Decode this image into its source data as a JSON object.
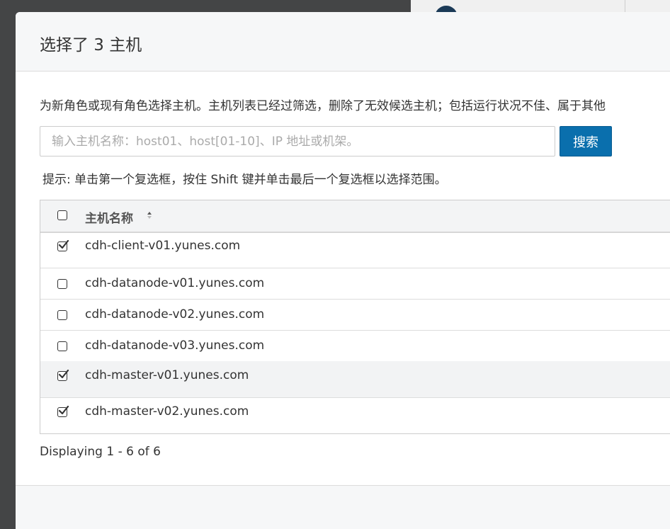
{
  "dialog": {
    "title": "选择了 3 主机",
    "description": "为新角色或现有角色选择主机。主机列表已经过筛选，删除了无效候选主机；包括运行状况不佳、属于其他",
    "search_placeholder": "输入主机名称：host01、host[01-10]、IP 地址或机架。",
    "search_value": "",
    "search_button": "搜索",
    "hint": "提示: 单击第一个复选框，按住 Shift 键并单击最后一个复选框以选择范围。",
    "table": {
      "column_header": "主机名称",
      "header_checked": false,
      "rows": [
        {
          "host": "cdh-client-v01.yunes.com",
          "checked": true
        },
        {
          "host": "cdh-datanode-v01.yunes.com",
          "checked": false
        },
        {
          "host": "cdh-datanode-v02.yunes.com",
          "checked": false
        },
        {
          "host": "cdh-datanode-v03.yunes.com",
          "checked": false
        },
        {
          "host": "cdh-master-v01.yunes.com",
          "checked": true
        },
        {
          "host": "cdh-master-v02.yunes.com",
          "checked": true
        }
      ]
    },
    "pagination": "Displaying 1 - 6 of 6"
  },
  "colors": {
    "primary_button": "#0a6fad",
    "backdrop": "#444546"
  }
}
